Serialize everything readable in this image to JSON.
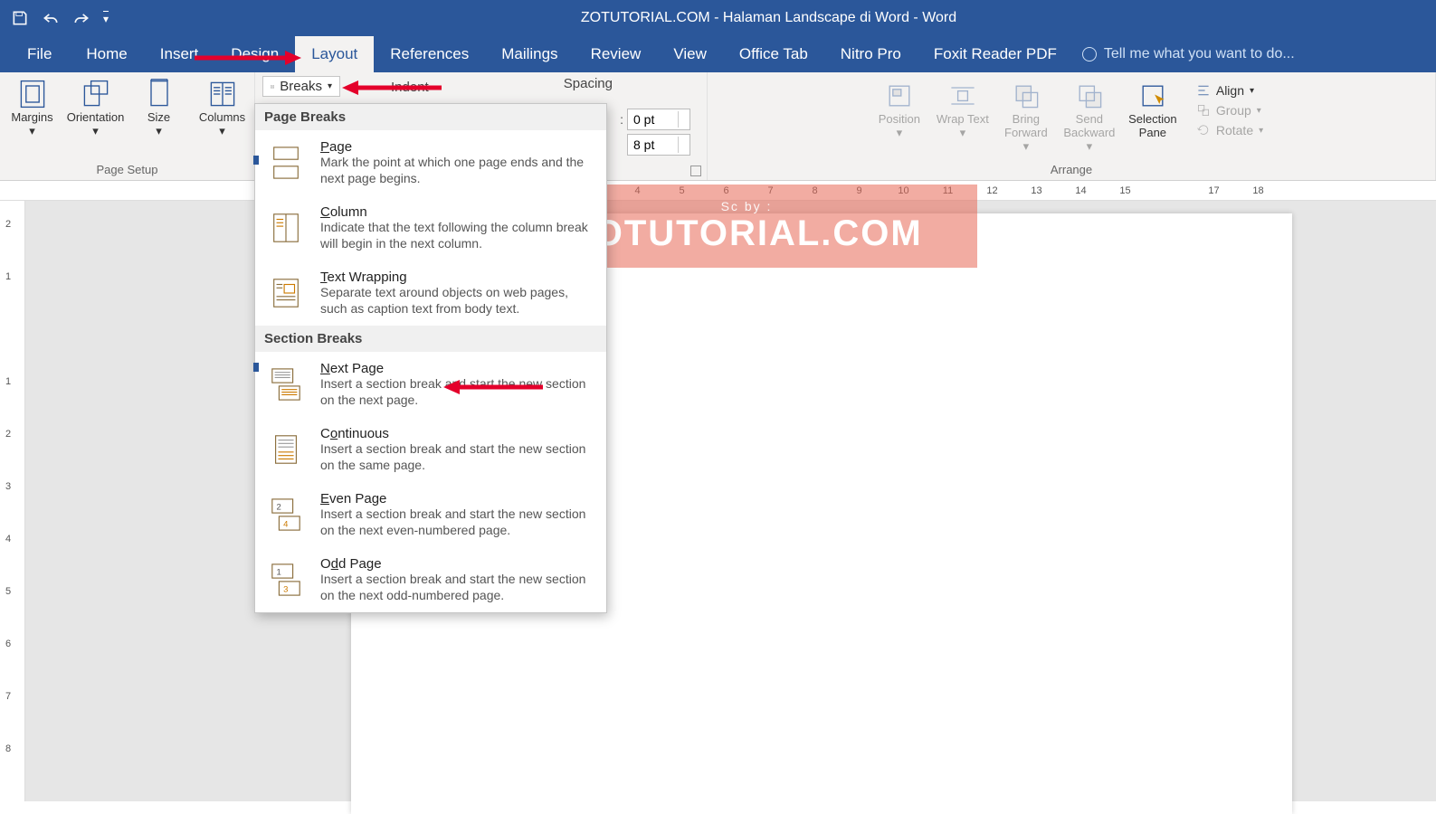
{
  "titlebar": {
    "title": "ZOTUTORIAL.COM - Halaman Landscape di Word - Word"
  },
  "tabs": {
    "file": "File",
    "home": "Home",
    "insert": "Insert",
    "design": "Design",
    "layout": "Layout",
    "references": "References",
    "mailings": "Mailings",
    "review": "Review",
    "view": "View",
    "office_tab": "Office Tab",
    "nitro": "Nitro Pro",
    "foxit": "Foxit Reader PDF",
    "tell_me": "Tell me what you want to do..."
  },
  "ribbon": {
    "page_setup": {
      "margins": "Margins",
      "orientation": "Orientation",
      "size": "Size",
      "columns": "Columns",
      "group_label": "Page Setup",
      "breaks": "Breaks",
      "indent": "Indent",
      "spacing_label": "Spacing"
    },
    "spacing": {
      "before": "0 pt",
      "after": "8 pt"
    },
    "arrange": {
      "position": "Position",
      "wrap": "Wrap Text",
      "bring": "Bring Forward",
      "send": "Send Backward",
      "selpane": "Selection Pane",
      "align": "Align",
      "group": "Group",
      "rotate": "Rotate",
      "group_label": "Arrange"
    }
  },
  "breaks_menu": {
    "page_breaks_header": "Page Breaks",
    "page": {
      "title": "Page",
      "desc": "Mark the point at which one page ends and the next page begins."
    },
    "column": {
      "title": "Column",
      "desc": "Indicate that the text following the column break will begin in the next column."
    },
    "text_wrap": {
      "title": "Text Wrapping",
      "desc": "Separate text around objects on web pages, such as caption text from body text."
    },
    "section_breaks_header": "Section Breaks",
    "next_page": {
      "title": "Next Page",
      "desc": "Insert a section break and start the new section on the next page."
    },
    "continuous": {
      "title": "Continuous",
      "desc": "Insert a section break and start the new section on the same page."
    },
    "even_page": {
      "title": "Even Page",
      "desc": "Insert a section break and start the new section on the next even-numbered page."
    },
    "odd_page": {
      "title": "Odd Page",
      "desc": "Insert a section break and start the new section on the next odd-numbered page."
    }
  },
  "ruler": {
    "h": [
      "4",
      "5",
      "6",
      "7",
      "8",
      "9",
      "10",
      "11",
      "12",
      "13",
      "14",
      "15",
      "",
      "17",
      "18"
    ],
    "v": [
      "2",
      "1",
      "",
      "1",
      "2",
      "3",
      "4",
      "5",
      "6",
      "7",
      "8"
    ]
  },
  "watermark": {
    "sc": "Sc by :",
    "text": "ZOTUTORIAL.COM"
  }
}
